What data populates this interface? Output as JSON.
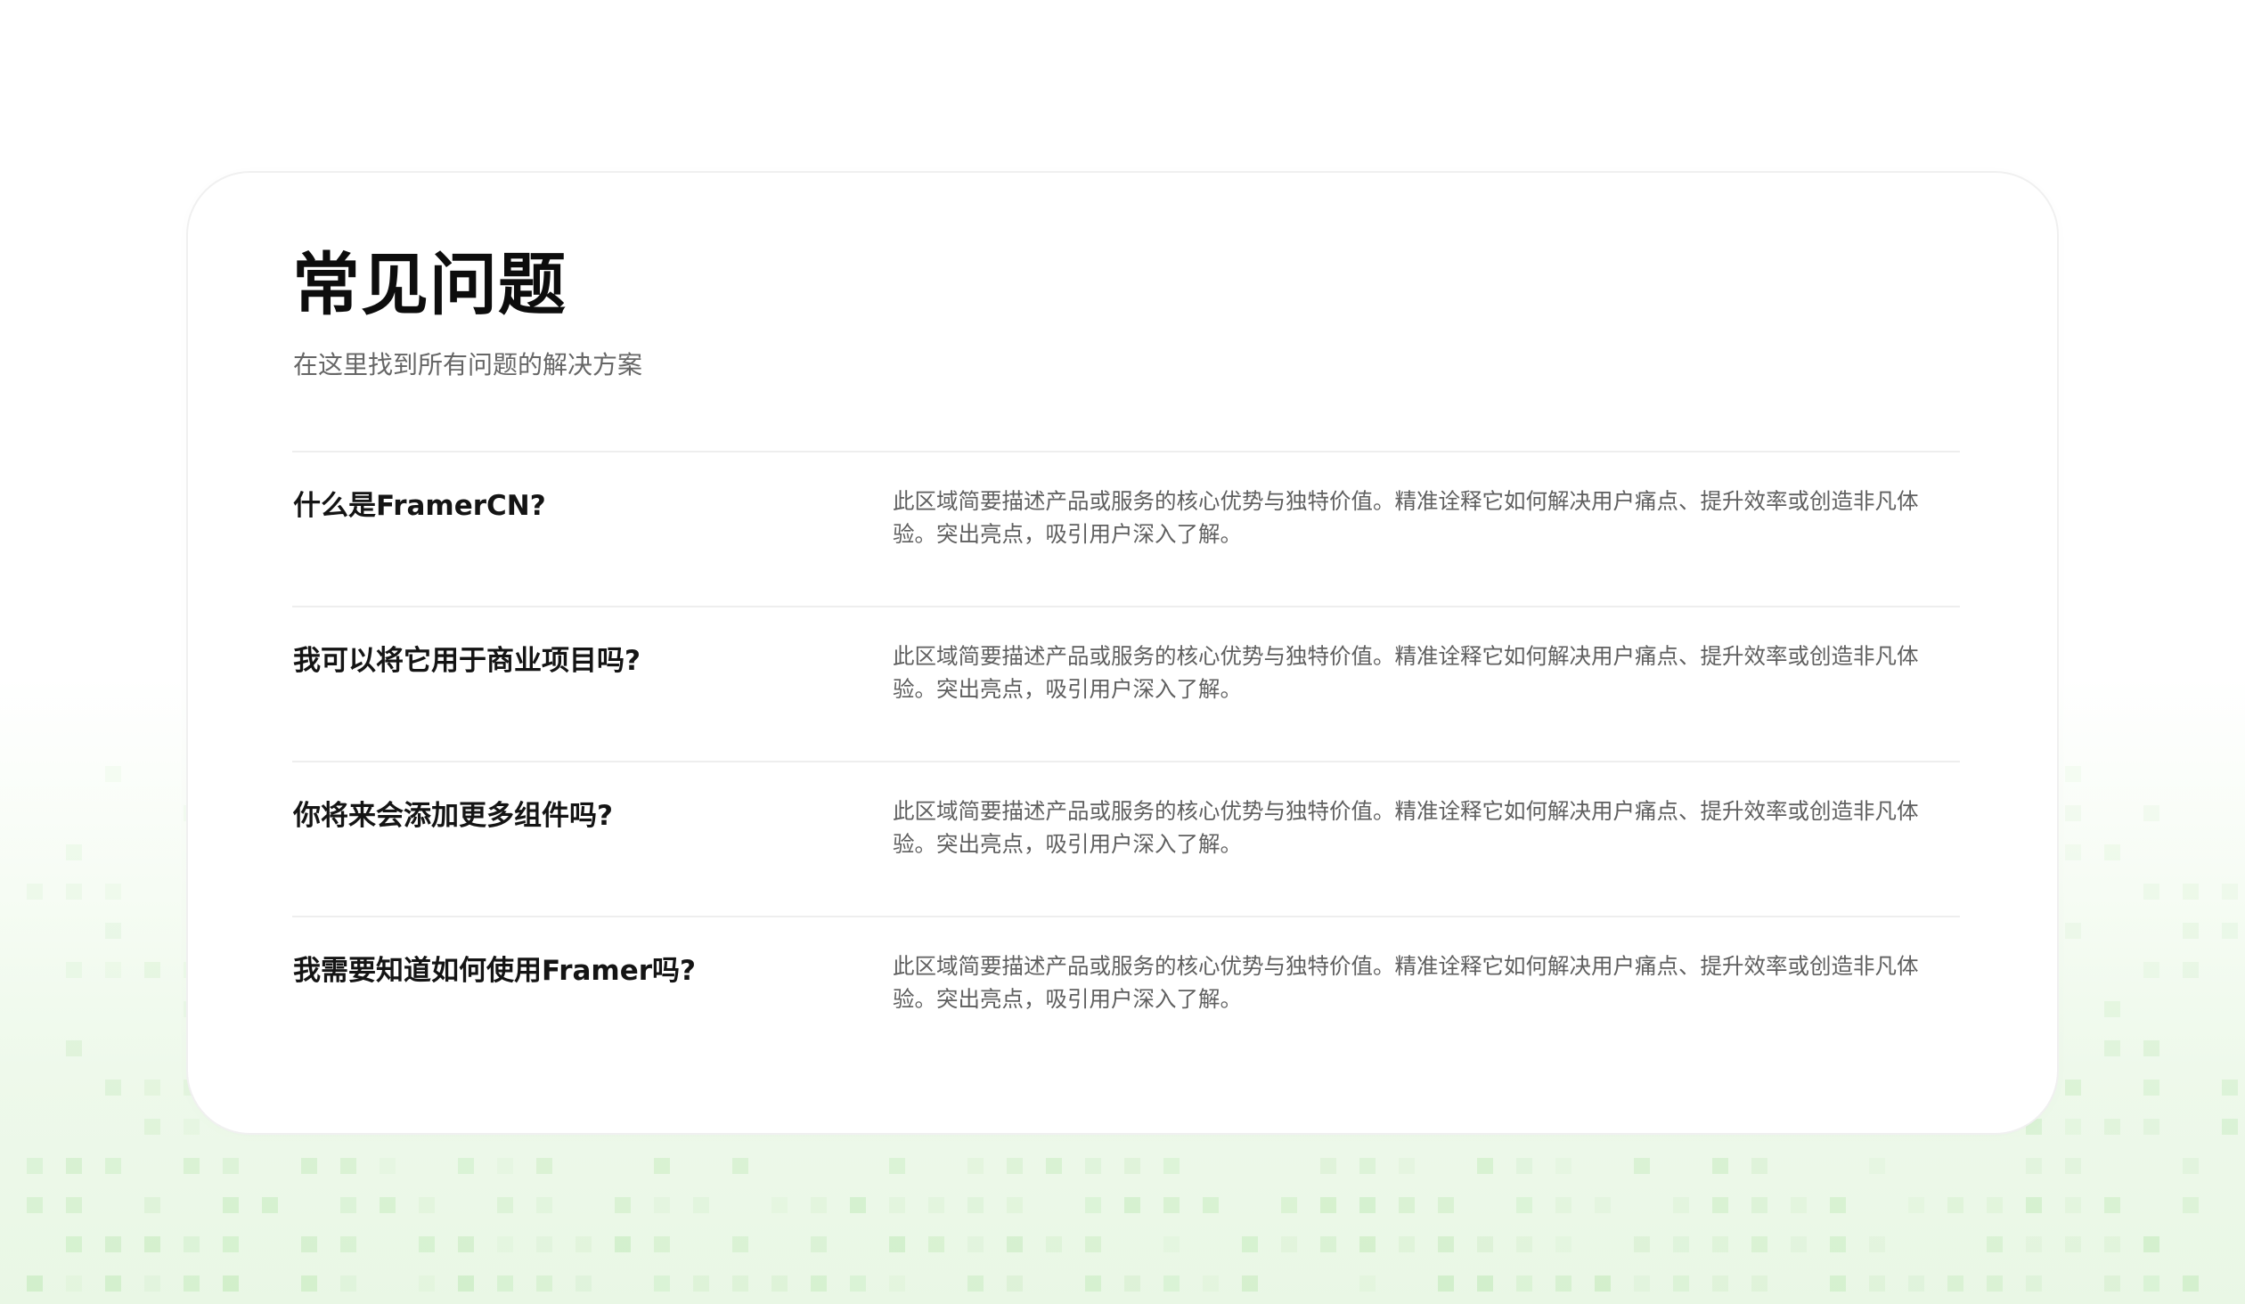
{
  "theme": {
    "accent": "#7bd46a",
    "background": "#ffffff",
    "card_background": "#ffffff",
    "title_color": "#0d0d0d",
    "answer_color": "#5f5f5f"
  },
  "faq": {
    "title": "常见问题",
    "subtitle": "在这里找到所有问题的解决方案",
    "items": [
      {
        "question": "什么是FramerCN?",
        "answer": "此区域简要描述产品或服务的核心优势与独特价值。精准诠释它如何解决用户痛点、提升效率或创造非凡体验。突出亮点，吸引用户深入了解。"
      },
      {
        "question": "我可以将它用于商业项目吗?",
        "answer": "此区域简要描述产品或服务的核心优势与独特价值。精准诠释它如何解决用户痛点、提升效率或创造非凡体验。突出亮点，吸引用户深入了解。"
      },
      {
        "question": "你将来会添加更多组件吗?",
        "answer": "此区域简要描述产品或服务的核心优势与独特价值。精准诠释它如何解决用户痛点、提升效率或创造非凡体验。突出亮点，吸引用户深入了解。"
      },
      {
        "question": "我需要知道如何使用Framer吗?",
        "answer": "此区域简要描述产品或服务的核心优势与独特价值。精准诠释它如何解决用户痛点、提升效率或创造非凡体验。突出亮点，吸引用户深入了解。"
      }
    ]
  }
}
